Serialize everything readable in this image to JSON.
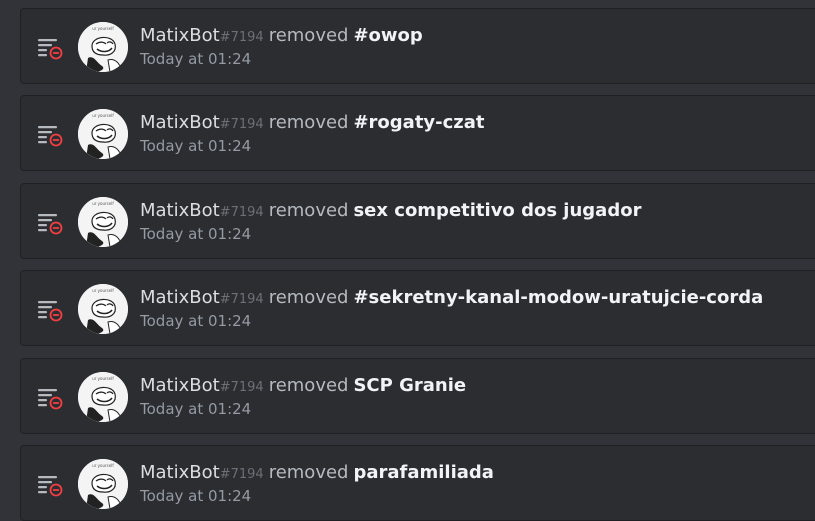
{
  "audit_log": {
    "entries": [
      {
        "user": "MatixBot",
        "discriminator": "#7194",
        "action": "removed",
        "target": "#owop",
        "time": "Today at 01:24",
        "icon": "channel-delete-icon"
      },
      {
        "user": "MatixBot",
        "discriminator": "#7194",
        "action": "removed",
        "target": "#rogaty-czat",
        "time": "Today at 01:24",
        "icon": "channel-delete-icon"
      },
      {
        "user": "MatixBot",
        "discriminator": "#7194",
        "action": "removed",
        "target": "sex competitivo dos jugador",
        "time": "Today at 01:24",
        "icon": "channel-delete-icon"
      },
      {
        "user": "MatixBot",
        "discriminator": "#7194",
        "action": "removed",
        "target": "#sekretny-kanal-modow-uratujcie-corda",
        "time": "Today at 01:24",
        "icon": "channel-delete-icon"
      },
      {
        "user": "MatixBot",
        "discriminator": "#7194",
        "action": "removed",
        "target": "SCP Granie",
        "time": "Today at 01:24",
        "icon": "channel-delete-icon"
      },
      {
        "user": "MatixBot",
        "discriminator": "#7194",
        "action": "removed",
        "target": "parafamiliada",
        "time": "Today at 01:24",
        "icon": "channel-delete-icon"
      }
    ]
  },
  "colors": {
    "background": "#313338",
    "row_background": "#2b2d31",
    "delete_red": "#f23f43",
    "icon_gray": "#b5bac1"
  }
}
